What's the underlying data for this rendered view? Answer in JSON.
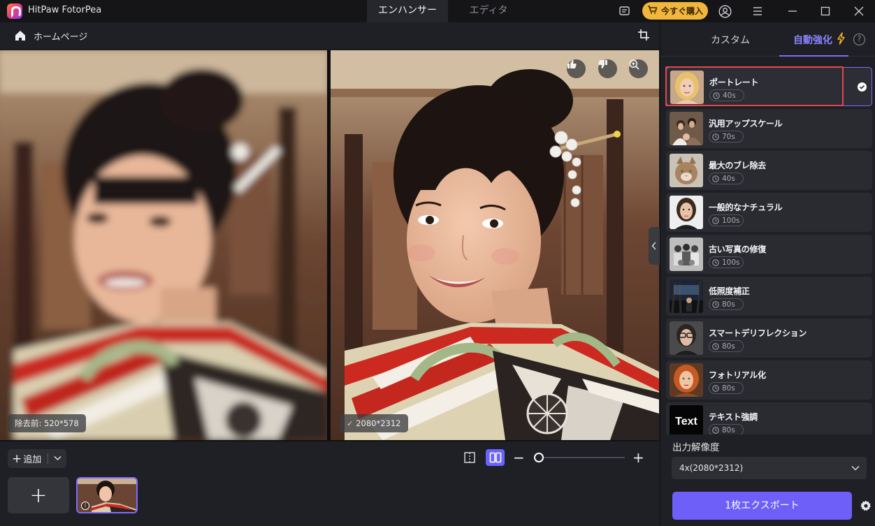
{
  "app": {
    "title": "HitPaw FotorPea"
  },
  "mode_tabs": [
    {
      "label": "エンハンサー",
      "active": true
    },
    {
      "label": "エディタ",
      "active": false
    }
  ],
  "titlebar": {
    "buy_label": "今すぐ購入",
    "buy_color": "#f1b63c"
  },
  "toolbar": {
    "home_label": "ホームページ"
  },
  "compare": {
    "before_label": "除去前: 520*578",
    "after_label": "2080*2312"
  },
  "bottom": {
    "add_label": "追加",
    "add_tile_symbol": "+",
    "thumb_info_symbol": "i"
  },
  "panel": {
    "tab_custom": "カスタム",
    "tab_auto": "自動強化",
    "help_symbol": "?",
    "accent_color": "#7c6cff",
    "presets": [
      {
        "name": "ポートレート",
        "time": "40s",
        "selected": true,
        "thumb": "portrait-blonde"
      },
      {
        "name": "汎用アップスケール",
        "time": "70s",
        "selected": false,
        "thumb": "family"
      },
      {
        "name": "最大のブレ除去",
        "time": "40s",
        "selected": false,
        "thumb": "cat"
      },
      {
        "name": "一般的なナチュラル",
        "time": "100s",
        "selected": false,
        "thumb": "woman-natural"
      },
      {
        "name": "古い写真の修復",
        "time": "100s",
        "selected": false,
        "thumb": "old-photo"
      },
      {
        "name": "低照度補正",
        "time": "80s",
        "selected": false,
        "thumb": "night"
      },
      {
        "name": "スマートデリフレクション",
        "time": "80s",
        "selected": false,
        "thumb": "glasses"
      },
      {
        "name": "フォトリアル化",
        "time": "80s",
        "selected": false,
        "thumb": "redhead"
      },
      {
        "name": "テキスト強調",
        "time": "80s",
        "selected": false,
        "thumb": "text",
        "thumb_text": "Text"
      }
    ],
    "output_label": "出力解像度",
    "output_value": "4x(2080*2312)",
    "export_label": "1枚エクスポート"
  }
}
